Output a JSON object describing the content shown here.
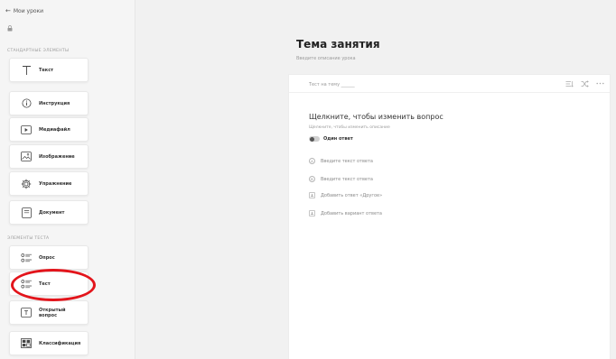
{
  "nav": {
    "back_label": "Мои уроки"
  },
  "sidebar": {
    "standard_section": "СТАНДАРТНЫЕ ЭЛЕМЕНТЫ",
    "test_section": "ЭЛЕМЕНТЫ ТЕСТА",
    "standard_items": [
      {
        "label": "Текст",
        "icon": "text-icon"
      },
      {
        "label": "Инструкция",
        "icon": "info-icon"
      },
      {
        "label": "Медиафайл",
        "icon": "media-icon"
      },
      {
        "label": "Изображение",
        "icon": "image-icon"
      },
      {
        "label": "Упражнение",
        "icon": "exercise-gear-icon"
      },
      {
        "label": "Документ",
        "icon": "document-icon"
      }
    ],
    "test_items": [
      {
        "label": "Опрос",
        "icon": "poll-icon"
      },
      {
        "label": "Тест",
        "icon": "test-list-icon"
      },
      {
        "label": "Открытый вопрос",
        "label_line1": "Открытый",
        "label_line2": "вопрос",
        "icon": "open-question-icon"
      },
      {
        "label": "Классификация",
        "icon": "classification-icon"
      }
    ],
    "highlight_color": "#e3141b"
  },
  "lesson": {
    "title": "Тема занятия",
    "description_placeholder": "Введите описание урока"
  },
  "card": {
    "test_name_placeholder": "Тест на тему ______",
    "question_title": "Щелкните, чтобы изменить вопрос",
    "question_desc": "Щелкните, чтобы изменить описание",
    "single_answer_label": "Один ответ",
    "answers": [
      {
        "placeholder": "Введите текст ответа",
        "marker": "A"
      },
      {
        "placeholder": "Введите текст ответа",
        "marker": "B"
      }
    ],
    "add_other_label": "Добавить ответ «Другое»",
    "add_option_label": "Добавить вариант ответа"
  }
}
